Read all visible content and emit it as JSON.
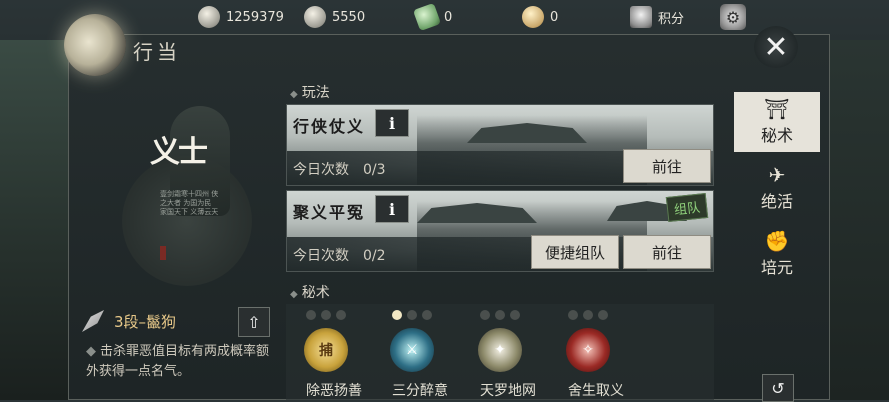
{
  "header": {
    "title": "行当",
    "resources": [
      {
        "icon": "film-reel-icon",
        "value": "1259379"
      },
      {
        "icon": "silver-ingot-icon",
        "value": "5550"
      },
      {
        "icon": "jade-token-icon",
        "value": "0"
      },
      {
        "icon": "gold-ingot-icon",
        "value": "0"
      },
      {
        "icon": "shield-icon",
        "label": "积分"
      }
    ]
  },
  "profile": {
    "title_glyph": "义士",
    "poem": "壹剑霜寒十四州 侠之大者 为国为民 家国天下 义薄云天",
    "rank": "3段–鬣狗",
    "description": "击杀罪恶值目标有两成概率额外获得一点名气。"
  },
  "sections": {
    "gameplay_label": "玩法",
    "skills_label": "秘术"
  },
  "activities": [
    {
      "name": "行侠仗义",
      "count_label": "今日次数",
      "count": "0/3",
      "go_label": "前往"
    },
    {
      "name": "聚义平冤",
      "count_label": "今日次数",
      "count": "0/2",
      "team_label": "便捷组队",
      "go_label": "前往",
      "badge": "组队"
    }
  ],
  "skills": [
    {
      "name": "除恶扬善",
      "icon_text": "捕",
      "dots": [
        0,
        0,
        0
      ],
      "color": "#c9a33c"
    },
    {
      "name": "三分醉意",
      "icon_text": "",
      "dots": [
        1,
        0,
        0
      ],
      "color": "#2e6f86"
    },
    {
      "name": "天罗地网",
      "icon_text": "",
      "dots": [
        0,
        0,
        0
      ],
      "color": "#8d8a6a"
    },
    {
      "name": "舍生取义",
      "icon_text": "",
      "dots": [
        0,
        0,
        0
      ],
      "color": "#9b2a25"
    }
  ],
  "sidebar": {
    "tabs": [
      {
        "label": "秘术",
        "icon": "scroll-icon",
        "glyph": "⛩"
      },
      {
        "label": "绝活",
        "icon": "airplane-icon",
        "glyph": "✈"
      },
      {
        "label": "培元",
        "icon": "arm-icon",
        "glyph": "✊"
      }
    ]
  },
  "colors": {
    "accent": "#e7c889",
    "panel": "#262e2f",
    "active_tab": "#e6e3da"
  }
}
